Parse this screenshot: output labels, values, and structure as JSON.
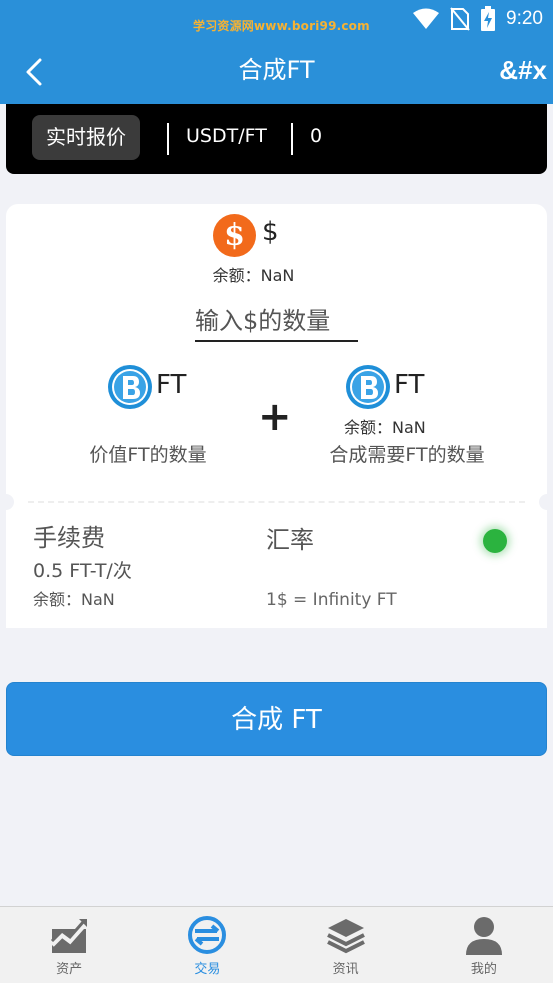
{
  "status_bar": {
    "watermark": "学习资源网www.bori99.com",
    "time": "9:20"
  },
  "header": {
    "title": "合成FT",
    "more_label": "&#x"
  },
  "ticker": {
    "tag": "实时报价",
    "pair": "USDT/FT",
    "price": "0"
  },
  "card": {
    "top_coin_symbol": "$",
    "top_coin_glyph": "$",
    "top_balance": "余额：NaN",
    "input_placeholder": "输入$的数量",
    "left_coin_symbol": "FT",
    "left_caption": "价值FT的数量",
    "right_coin_symbol": "FT",
    "right_balance": "余额：NaN",
    "right_caption": "合成需要FT的数量",
    "plus": "+",
    "fee_label": "手续费",
    "fee_value": "0.5 FT-T/次",
    "fee_balance": "余额：NaN",
    "rate_label": "汇率",
    "rate_value": "1$ = Infinity FT"
  },
  "submit_label": "合成 FT",
  "bottom_nav": [
    {
      "label": "资产",
      "icon": "chart-trend-icon",
      "active": false
    },
    {
      "label": "交易",
      "icon": "exchange-icon",
      "active": true
    },
    {
      "label": "资讯",
      "icon": "layers-icon",
      "active": false
    },
    {
      "label": "我的",
      "icon": "user-icon",
      "active": false
    }
  ],
  "colors": {
    "primary": "#2a90d9",
    "orange": "#f26a1b",
    "green": "#2bb33f",
    "watermark": "#f6b233"
  }
}
